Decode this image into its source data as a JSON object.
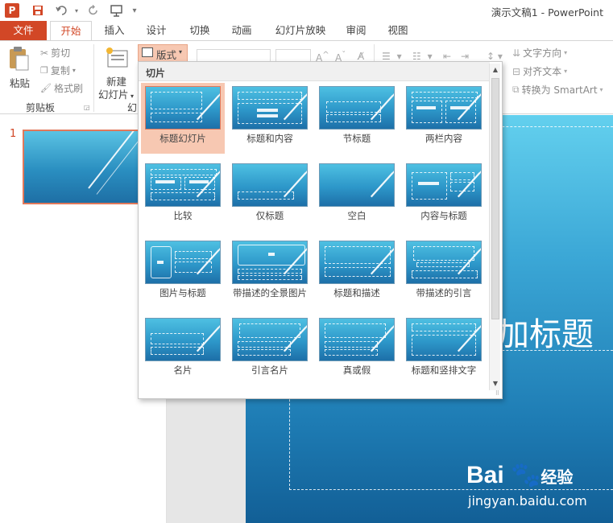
{
  "window": {
    "title": "演示文稿1 - PowerPoint",
    "logo_letter": "P"
  },
  "tabs": [
    "文件",
    "开始",
    "插入",
    "设计",
    "切换",
    "动画",
    "幻灯片放映",
    "审阅",
    "视图"
  ],
  "ribbon": {
    "clipboard": {
      "paste": "粘贴",
      "cut": "剪切",
      "copy": "复制",
      "format_painter": "格式刷",
      "group_label": "剪贴板"
    },
    "slides": {
      "new_slide_line1": "新建",
      "new_slide_line2": "幻灯片",
      "group_label_partial": "幻",
      "layout_button": "版式"
    },
    "paragraph": {
      "text_direction": "文字方向",
      "align_text": "对齐文本",
      "convert_smartart": "转换为 SmartArt"
    }
  },
  "slides_panel": {
    "slide_number": "1"
  },
  "slide_canvas": {
    "title_partial": "加标题"
  },
  "layout_gallery": {
    "header": "切片",
    "layouts": [
      {
        "label": "标题幻灯片",
        "selected": true
      },
      {
        "label": "标题和内容",
        "selected": false
      },
      {
        "label": "节标题",
        "selected": false
      },
      {
        "label": "两栏内容",
        "selected": false
      },
      {
        "label": "比较",
        "selected": false
      },
      {
        "label": "仅标题",
        "selected": false
      },
      {
        "label": "空白",
        "selected": false
      },
      {
        "label": "内容与标题",
        "selected": false
      },
      {
        "label": "图片与标题",
        "selected": false
      },
      {
        "label": "带描述的全景图片",
        "selected": false
      },
      {
        "label": "标题和描述",
        "selected": false
      },
      {
        "label": "带描述的引言",
        "selected": false
      },
      {
        "label": "名片",
        "selected": false
      },
      {
        "label": "引言名片",
        "selected": false
      },
      {
        "label": "真或假",
        "selected": false
      },
      {
        "label": "标题和竖排文字",
        "selected": false
      }
    ]
  },
  "watermark": {
    "brand": "Bai",
    "brand_suffix": "经验",
    "url": "jingyan.baidu.com"
  },
  "colors": {
    "accent": "#d24726",
    "selection": "#f7c8b2",
    "slide_blue": "#2a8ec0"
  }
}
